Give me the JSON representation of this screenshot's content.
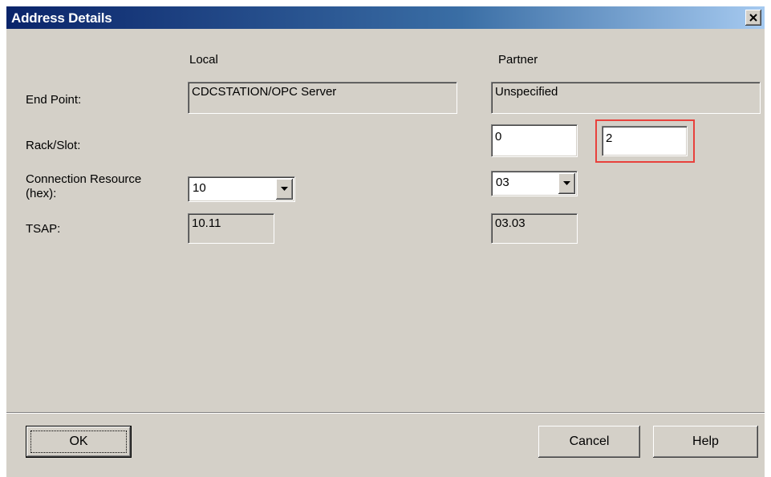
{
  "window": {
    "title": "Address Details",
    "close_icon": "close-icon"
  },
  "columns": {
    "local": "Local",
    "partner": "Partner"
  },
  "rows": {
    "end_point_label": "End Point:",
    "rack_slot_label": "Rack/Slot:",
    "connection_resource_label_line1": "Connection Resource",
    "connection_resource_label_line2": "(hex):",
    "tsap_label": "TSAP:"
  },
  "local": {
    "end_point": "CDCSTATION/OPC Server",
    "connection_resource": "10",
    "tsap": "10.11"
  },
  "partner": {
    "end_point": "Unspecified",
    "rack": "0",
    "slot": "2",
    "connection_resource": "03",
    "tsap": "03.03"
  },
  "buttons": {
    "ok": "OK",
    "cancel": "Cancel",
    "help": "Help"
  },
  "colors": {
    "highlight": "#e8413c",
    "titlebar_start": "#0a246a",
    "face": "#d4d0c8"
  }
}
